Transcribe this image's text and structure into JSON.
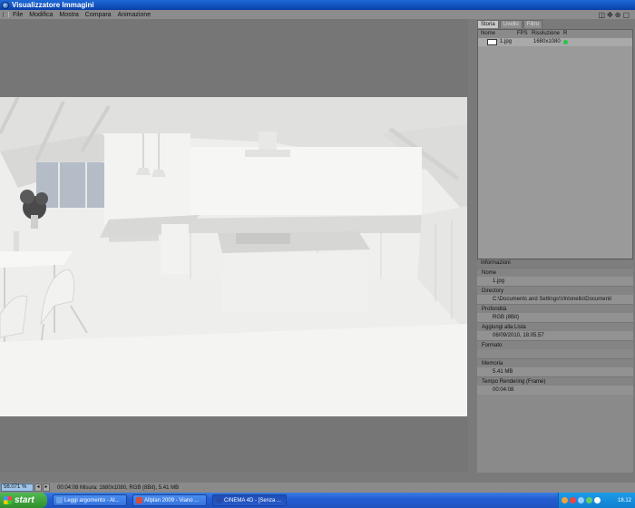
{
  "window": {
    "title": "Visualizzatore Immagini"
  },
  "menu": [
    "File",
    "Modifica",
    "Mostra",
    "Compara",
    "Animazione"
  ],
  "tabs": [
    {
      "label": "Storia",
      "active": true
    },
    {
      "label": "Livello",
      "active": false
    },
    {
      "label": "Filtro",
      "active": false
    }
  ],
  "history": {
    "columns": [
      "Nome",
      "FPS",
      "Risoluzione",
      "R"
    ],
    "rows": [
      {
        "name": "1.jpg",
        "fps": "",
        "resolution": "1680x1080"
      }
    ]
  },
  "info": {
    "title": "Informazioni",
    "fields": [
      {
        "label": "Nome",
        "value": "1.jpg"
      },
      {
        "label": "Directory",
        "value": "C:\\Documents and Settings\\Vinlonello\\Documenti"
      },
      {
        "label": "Profondità",
        "value": "RGB (8Bit)"
      },
      {
        "label": "Aggiungi alla Lista",
        "value": "06/09/2010, 18.05.57"
      },
      {
        "label": "Formato",
        "value": ""
      },
      {
        "label": "Memoria",
        "value": "5.41 MB"
      },
      {
        "label": "Tempo Rendering (Frame)",
        "value": "00:04:08"
      }
    ]
  },
  "status": {
    "zoom": "56.071 %",
    "text": "00:04:08  Misura: 1680x1080, RGB (8Bit), 5.41 MB"
  },
  "taskbar": {
    "start": "start",
    "tasks": [
      {
        "label": "Leggi argomento - At...",
        "color": "#6a9fe8"
      },
      {
        "label": "Allplan 2009 - Viano ...",
        "color": "#d84a3a"
      },
      {
        "label": "CINEMA 4D - [Senza ...",
        "color": "#2a4aa8"
      }
    ],
    "clock": "18.12"
  }
}
